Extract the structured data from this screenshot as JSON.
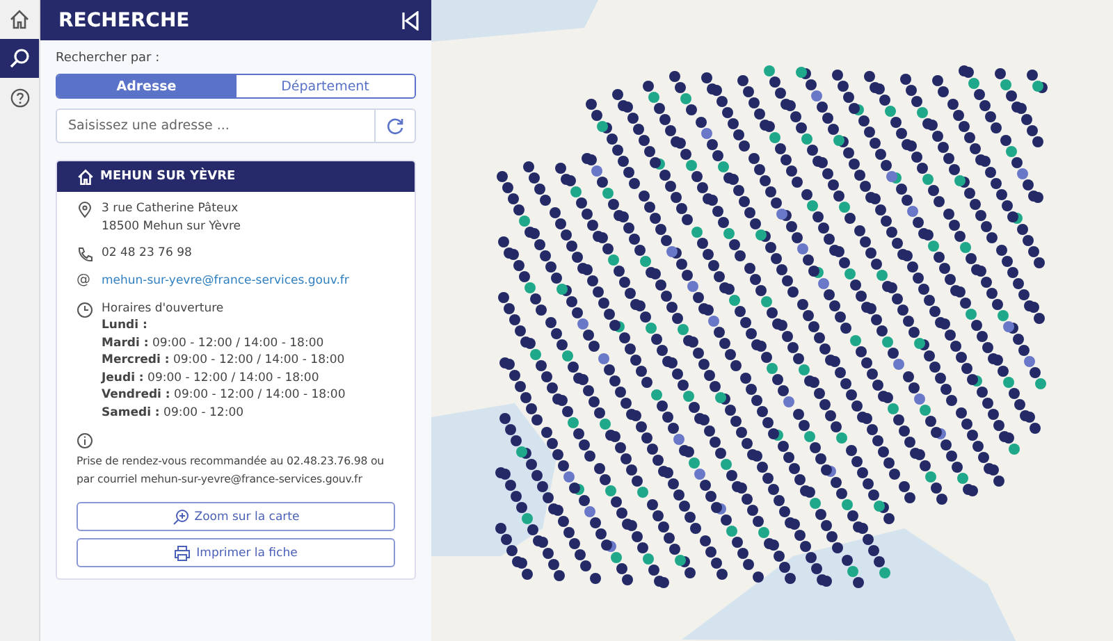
{
  "rail": [
    {
      "kind": "home",
      "selected": false
    },
    {
      "kind": "search",
      "selected": true
    },
    {
      "kind": "help",
      "selected": false
    }
  ],
  "panel": {
    "title": "RECHERCHE",
    "search_by_label": "Rechercher par :",
    "tabs": [
      {
        "label": "Adresse",
        "selected": true
      },
      {
        "label": "Département",
        "selected": false
      }
    ],
    "address_field": {
      "placeholder": "Saisissez une adresse ..."
    }
  },
  "card": {
    "title": "MEHUN SUR YÈVRE",
    "address": [
      "3 rue Catherine Pâteux",
      "18500 Mehun sur Yèvre"
    ],
    "phone": "02 48 23 76 98",
    "email_marker": "@",
    "email": "mehun-sur-yevre@france-services.gouv.fr",
    "hours_title": "Horaires d'ouverture",
    "hours": [
      "**Lundi :**",
      "**Mardi :** 09:00 - 12:00 / 14:00 - 18:00",
      "**Mercredi :** 09:00 - 12:00 / 14:00 - 18:00",
      "**Jeudi :** 09:00 - 12:00 / 14:00 - 18:00",
      "**Vendredi :** 09:00 - 12:00 / 14:00 - 18:00",
      "**Samedi :** 09:00 - 12:00"
    ],
    "info": "Prise de rendez-vous recommandée au 02.48.23.76.98 ou par courriel mehun-sur-yevre@france-services.gouv.fr",
    "buttons": [
      {
        "kind": "zoom",
        "label": "Zoom sur la carte"
      },
      {
        "kind": "print",
        "label": "Imprimer la fiche"
      }
    ]
  }
}
